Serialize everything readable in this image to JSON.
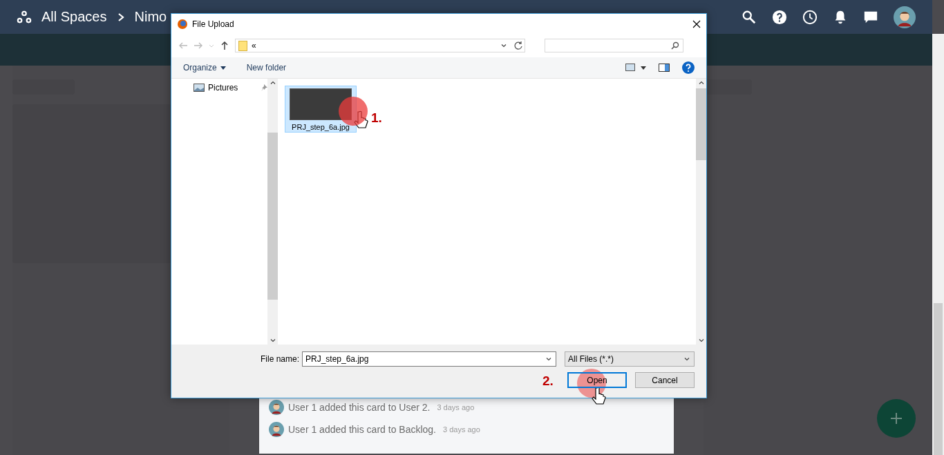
{
  "header": {
    "breadcrumb": [
      "All Spaces",
      "Nimo"
    ]
  },
  "dialog": {
    "title": "File Upload",
    "address": "«",
    "commands": [
      {
        "label": "Organize",
        "kind": "menu"
      },
      {
        "label": "New folder",
        "kind": "plain"
      }
    ],
    "nav_items": [
      {
        "label": "Pictures"
      }
    ],
    "files": [
      {
        "name": "PRJ_step_6a.jpg",
        "selected": true
      }
    ],
    "file_name_label": "File name:",
    "file_name_value": "PRJ_step_6a.jpg",
    "file_type": "All Files (*.*)",
    "buttons": [
      {
        "label": "Open",
        "kind": "primary"
      },
      {
        "label": "Cancel",
        "kind": "secondary"
      }
    ]
  },
  "annotations": [
    {
      "label": "1."
    },
    {
      "label": "2."
    }
  ],
  "activity": [
    {
      "text": "User 1 added this card to User 2.",
      "time": "3 days ago"
    },
    {
      "text": "User 1 added this card to Backlog.",
      "time": "3 days ago"
    }
  ]
}
